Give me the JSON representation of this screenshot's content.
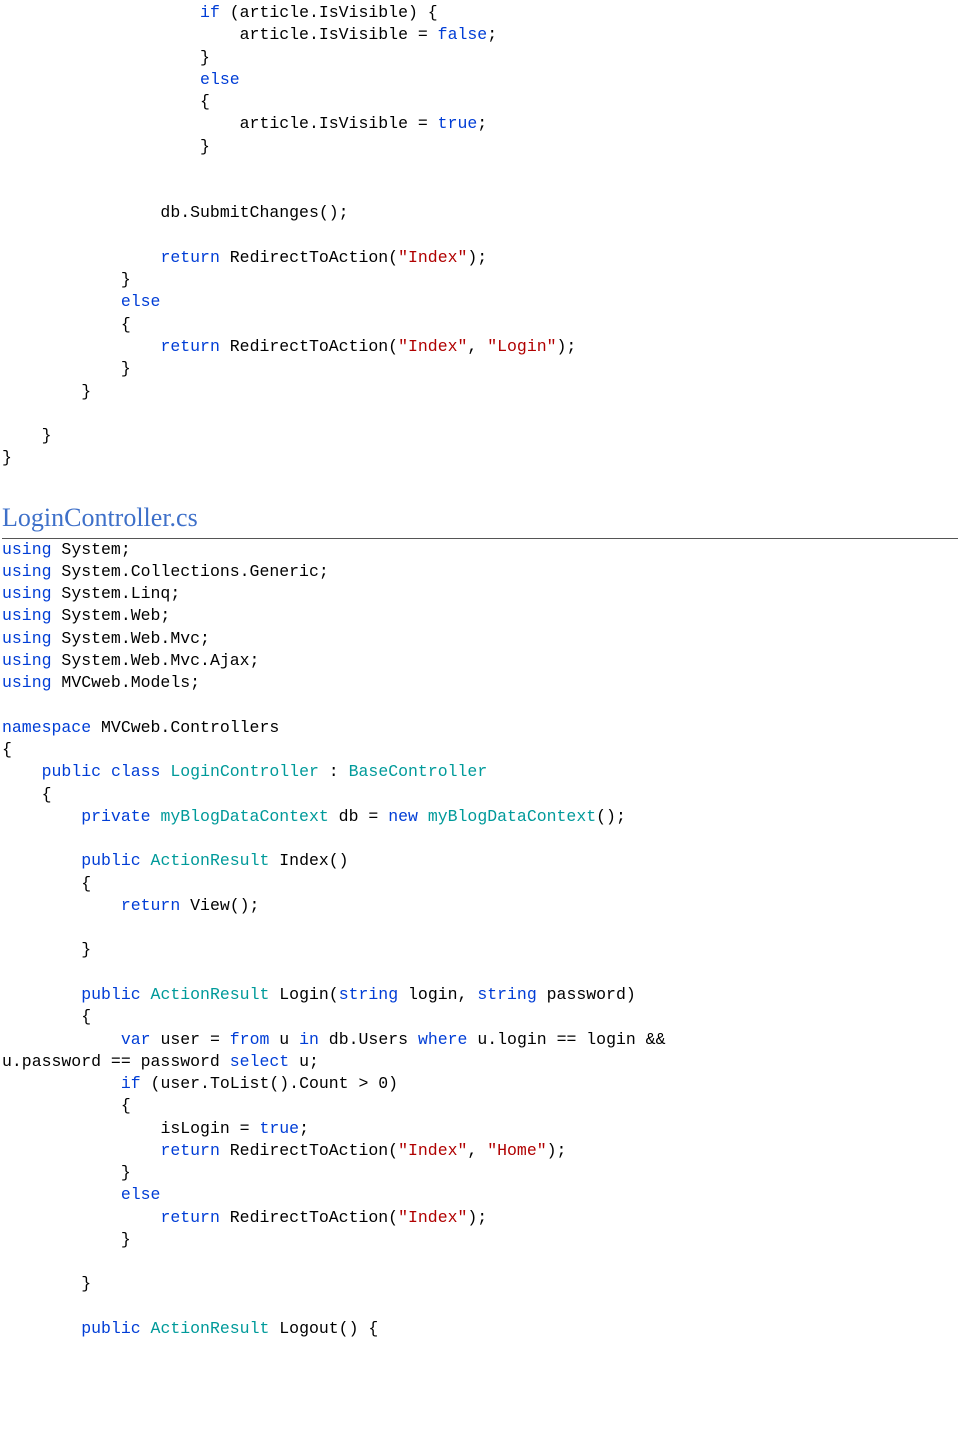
{
  "code1": {
    "t0a": "                    ",
    "t0b": " (article.IsVisible) {",
    "t1": "                        article.IsVisible = ",
    "t1b": ";",
    "t2": "                    }",
    "t3a": "                    ",
    "t4": "                    {",
    "t5": "                        article.IsVisible = ",
    "t5b": ";",
    "t6": "                    }",
    "blank": "",
    "t7": "                db.SubmitChanges();",
    "t8a": "                ",
    "t8b": " RedirectToAction(",
    "t8c": ");",
    "t9": "            }",
    "t10a": "            ",
    "t11": "            {",
    "t12a": "                ",
    "t12b": " RedirectToAction(",
    "t12c": ", ",
    "t12d": ");",
    "t13": "            }",
    "t14": "        }",
    "t15": "    }",
    "t16": "}",
    "kw_if": "if",
    "kw_else": "else",
    "kw_return": "return",
    "kw_false": "false",
    "kw_true": "true",
    "str_index": "\"Index\"",
    "str_login": "\"Login\""
  },
  "heading": "LoginController.cs",
  "code2": {
    "using": "using",
    "ns1": " System;",
    "ns2": " System.Collections.Generic;",
    "ns3": " System.Linq;",
    "ns4": " System.Web;",
    "ns5": " System.Web.Mvc;",
    "ns6": " System.Web.Mvc.Ajax;",
    "ns7": " MVCweb.Models;",
    "kw_namespace": "namespace",
    "ns_name": " MVCweb.Controllers",
    "obrace": "{",
    "cbrace": "}",
    "ind1": "    ",
    "ind2": "        ",
    "ind3": "            ",
    "ind4": "                ",
    "kw_public": "public",
    "kw_class": "class",
    "kw_private": "private",
    "kw_new": "new",
    "kw_return": "return",
    "kw_var": "var",
    "kw_from": "from",
    "kw_in": "in",
    "kw_where": "where",
    "kw_select": "select",
    "kw_if": "if",
    "kw_else": "else",
    "kw_true": "true",
    "kw_string": "string",
    "type_login": "LoginController",
    "type_base": "BaseController",
    "type_ctx": "myBlogDataContext",
    "type_ar": "ActionResult",
    "class_line_b": " : ",
    "priv_a": " db = ",
    "priv_b": " ",
    "priv_c": "();",
    "idx_sig": " Index()",
    "ret_view": " View();",
    "login_sig_a": " Login(",
    "login_sig_b": " login, ",
    "login_sig_c": " password)",
    "var_line_a": " user = ",
    "var_line_b": " u ",
    "var_line_c": " db.Users ",
    "var_line_d": " u.login == login && ",
    "var_line2_a": "u.password == password ",
    "var_line2_b": " u;",
    "if_cond": " (user.ToList().Count > 0)",
    "islogin_a": "isLogin = ",
    "islogin_b": ";",
    "rta_a": " RedirectToAction(",
    "rta_b": ", ",
    "rta_c": ");",
    "rta_single": ");",
    "str_index": "\"Index\"",
    "str_home": "\"Home\"",
    "logout_sig": " Logout() {",
    "sp": " "
  }
}
